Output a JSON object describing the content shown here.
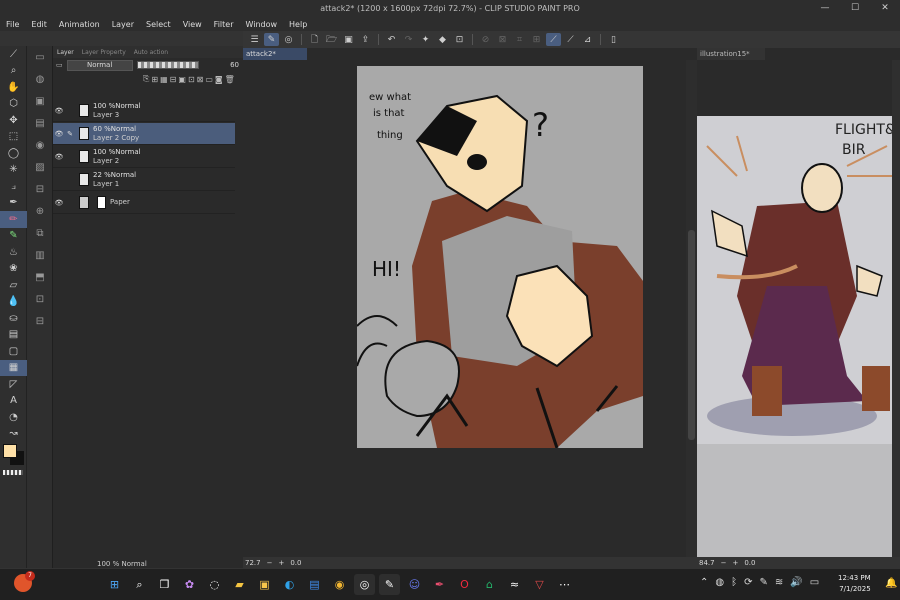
{
  "window": {
    "title": "attack2* (1200 x 1600px 72dpi 72.7%) - CLIP STUDIO PAINT PRO",
    "controls": [
      "—",
      "☐",
      "✕"
    ]
  },
  "menu": [
    "File",
    "Edit",
    "Animation",
    "Layer",
    "Select",
    "View",
    "Filter",
    "Window",
    "Help"
  ],
  "layer_panel": {
    "tabs": [
      "Layer",
      "Layer Property",
      "Auto action"
    ],
    "blend_mode": "Normal",
    "opacity": "60",
    "layers": [
      {
        "opacity": "100 %",
        "mode": "Normal",
        "name": "Layer 3",
        "visible": true,
        "selected": false
      },
      {
        "opacity": "60 %",
        "mode": "Normal",
        "name": "Layer 2 Copy",
        "visible": true,
        "selected": true
      },
      {
        "opacity": "100 %",
        "mode": "Normal",
        "name": "Layer 2",
        "visible": true,
        "selected": false
      },
      {
        "opacity": "22 %",
        "mode": "Normal",
        "name": "Layer 1",
        "visible": false,
        "selected": false
      },
      {
        "opacity": "",
        "mode": "",
        "name": "Paper",
        "visible": true,
        "selected": false
      }
    ],
    "bottom_row": "100 % Normal"
  },
  "canvas": {
    "tab_label": "attack2*",
    "zoom": "72.7",
    "rotation": "0.0",
    "doodles": {
      "speech": [
        "ew what",
        "is that",
        "thing"
      ],
      "question": "?",
      "hi": "HI!"
    }
  },
  "reference": {
    "tab_label": "illustration15*",
    "zoom": "84.7",
    "rotation": "0.0",
    "text": [
      "FLIGHT&",
      "BIR"
    ]
  },
  "taskbar": {
    "notification_count": "7",
    "time": "12:43 PM",
    "date": "7/1/2025"
  },
  "colors": {
    "main": "#ffe1a8",
    "sub": "#111111",
    "accent": "#4a5e80"
  }
}
